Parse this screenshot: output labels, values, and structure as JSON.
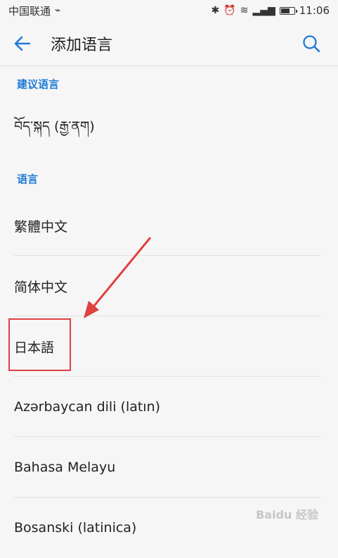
{
  "status_bar": {
    "carrier": "中国联通",
    "time": "11:06",
    "icons": [
      "bluetooth-icon",
      "alarm-icon",
      "wifi-icon",
      "signal-icon",
      "battery-icon"
    ]
  },
  "app_bar": {
    "title": "添加语言",
    "back_icon": "back-arrow-icon",
    "search_icon": "search-icon",
    "accent": "#1e7ad6"
  },
  "sections": {
    "suggested_header": "建议语言",
    "languages_header": "语言"
  },
  "suggested": [
    {
      "label": "བོད་སྐད (རྒྱ་ནག)"
    }
  ],
  "languages": [
    {
      "label": "繁體中文"
    },
    {
      "label": "简体中文"
    },
    {
      "label": "日本語"
    },
    {
      "label": "Azərbaycan dili (latın)"
    },
    {
      "label": "Bahasa Melayu"
    },
    {
      "label": "Bosanski (latinica)"
    }
  ],
  "annotation": {
    "highlight_color": "#e04040"
  },
  "watermark": "Baidu 经验"
}
